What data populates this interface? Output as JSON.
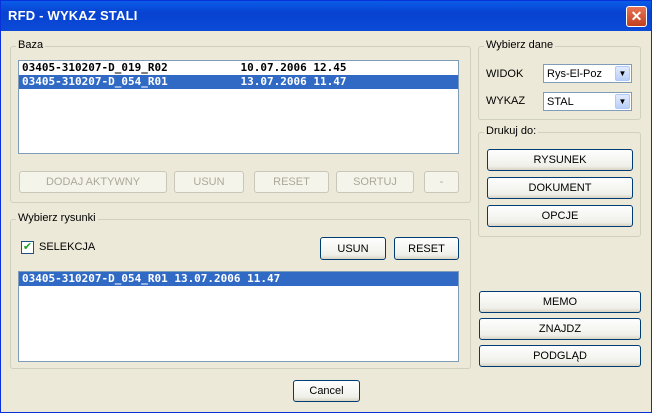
{
  "window": {
    "title": "RFD - WYKAZ STALI",
    "close_symbol": "✕"
  },
  "baza": {
    "label": "Baza",
    "rows": [
      "03405-310207-D_019_R02           10.07.2006 12.45",
      "03405-310207-D_054_R01           13.07.2006 11.47"
    ],
    "selected_index": 1,
    "buttons": {
      "dodaj": "DODAJ AKTYWNY",
      "usun": "USUN",
      "reset": "RESET",
      "sortuj": "SORTUJ",
      "minus": "-"
    }
  },
  "rysunki": {
    "label": "Wybierz rysunki",
    "selekcja_label": "SELEKCJA",
    "selekcja_checked": true,
    "check_mark": "✔",
    "buttons": {
      "usun": "USUN",
      "reset": "RESET"
    },
    "rows": [
      "03405-310207-D_054_R01 13.07.2006 11.47"
    ],
    "selected_index": 0
  },
  "dane": {
    "label": "Wybierz dane",
    "widok_label": "WIDOK",
    "widok_value": "Rys-El-Poz",
    "wykaz_label": "WYKAZ",
    "wykaz_value": "STAL",
    "arrow": "▼"
  },
  "drukuj": {
    "label": "Drukuj do:",
    "buttons": {
      "rysunek": "RYSUNEK",
      "dokument": "DOKUMENT",
      "opcje": "OPCJE"
    }
  },
  "side_buttons": {
    "memo": "MEMO",
    "znajdz": "ZNAJDZ",
    "podglad": "PODGLĄD"
  },
  "cancel_label": "Cancel",
  "colors": {
    "titlebar": "#0a4ad6",
    "selection": "#316ac5",
    "face": "#ece9d8"
  }
}
